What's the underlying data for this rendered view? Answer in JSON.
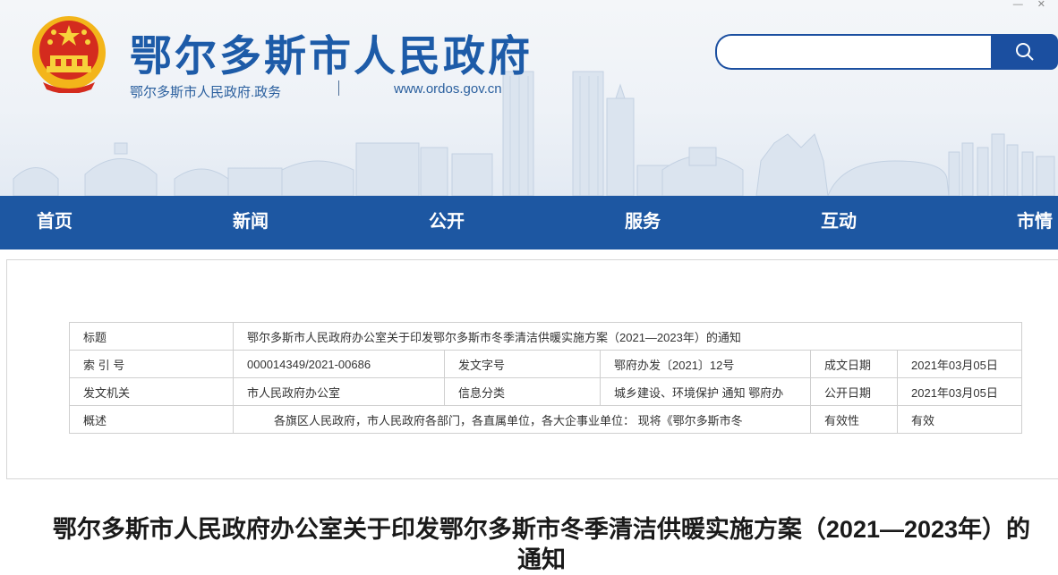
{
  "window": {
    "minimize_icon": "minimize-icon",
    "close_icon": "close-icon"
  },
  "header": {
    "title": "鄂尔多斯市人民政府",
    "subtitle": "鄂尔多斯市人民政府.政务",
    "url": "www.ordos.gov.cn",
    "emblem_icon": "national-emblem-icon",
    "search": {
      "placeholder": "",
      "button_icon": "search-icon"
    },
    "brand_color": "#1d5ba8"
  },
  "nav": {
    "items": [
      {
        "label": "首页"
      },
      {
        "label": "新闻"
      },
      {
        "label": "公开"
      },
      {
        "label": "服务"
      },
      {
        "label": "互动"
      },
      {
        "label": "市情"
      }
    ],
    "background": "#1d57a2"
  },
  "meta_table": {
    "row1": {
      "label": "标题",
      "value": "鄂尔多斯市人民政府办公室关于印发鄂尔多斯市冬季清洁供暖实施方案（2021—2023年）的通知"
    },
    "row2": {
      "label1": "索 引 号",
      "value1": "000014349/2021-00686",
      "label2": "发文字号",
      "value2": "鄂府办发〔2021〕12号",
      "label3": "成文日期",
      "value3": "2021年03月05日"
    },
    "row3": {
      "label1": "发文机关",
      "value1": "市人民政府办公室",
      "label2": "信息分类",
      "value2": "城乡建设、环境保护  通知  鄂府办",
      "label3": "公开日期",
      "value3": "2021年03月05日"
    },
    "row4": {
      "label1": "概述",
      "value1": "各旗区人民政府，市人民政府各部门，各直属单位，各大企事业单位：      现将《鄂尔多斯市冬",
      "label2": "有效性",
      "value2": "有效"
    }
  },
  "article": {
    "headline": "鄂尔多斯市人民政府办公室关于印发鄂尔多斯市冬季清洁供暖实施方案（2021—2023年）的通知"
  }
}
